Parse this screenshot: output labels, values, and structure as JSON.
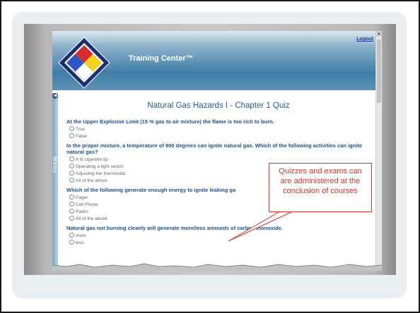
{
  "app": {
    "title": "Training Center™",
    "logout_label": "Logout",
    "menu_label": "Menu"
  },
  "quiz": {
    "title": "Natural Gas Hazards I - Chapter 1 Quiz",
    "questions": [
      {
        "text": "At the Upper Explosive Limit (15 % gas to air mixture) the flame is too rich to burn.",
        "options": [
          "True",
          "False"
        ]
      },
      {
        "text": "In the proper mixture, a temperature of 900 degrees can ignite natural gas. Which of the following activities can ignite natural gas?",
        "options": [
          "A lit cigarette tip",
          "Operating a light switch",
          "Adjusting the thermostat",
          "All of the above"
        ]
      },
      {
        "text": "Which of the following generate enough energy to ignite leaking ga",
        "options": [
          "Pager",
          "Cell Phone",
          "Radio",
          "All of the above"
        ]
      },
      {
        "text": "Natural gas not burning cleanly will generate more/less amounts of carbon monoxide.",
        "options": [
          "more",
          "less"
        ]
      }
    ]
  },
  "callout": {
    "text": "Quizzes and exams can are administered at the conclusion of courses",
    "color": "#c0392b"
  },
  "colors": {
    "header_blue": "#3f7ea6",
    "question_blue": "#1f4f8a",
    "title_blue": "#2c5b8c"
  }
}
